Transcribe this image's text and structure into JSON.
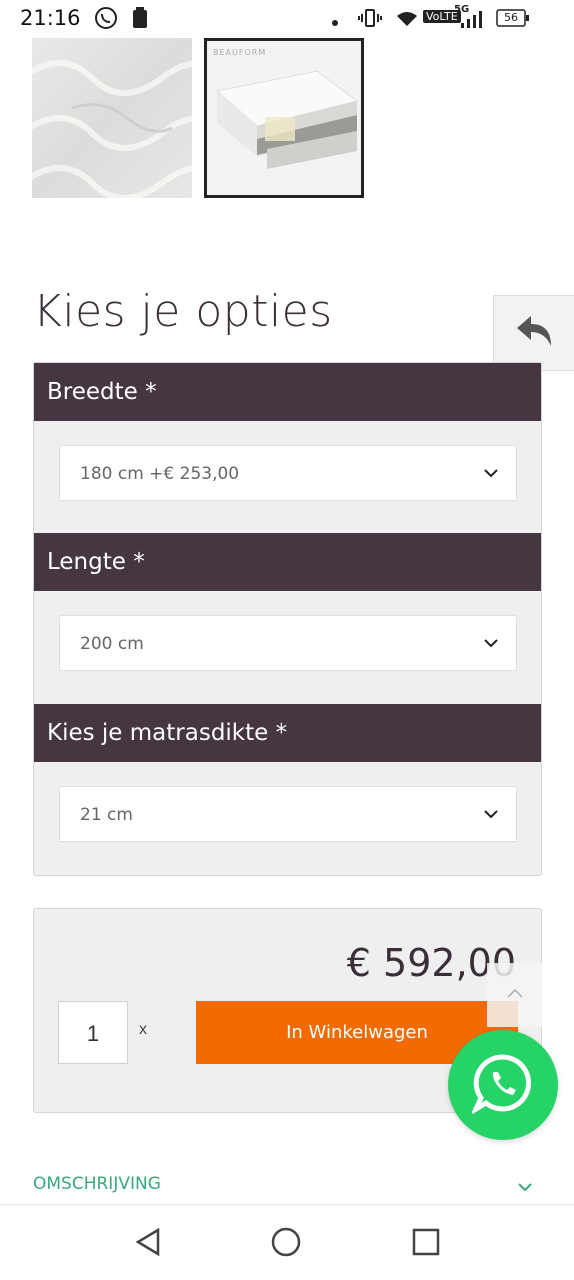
{
  "status_bar": {
    "time": "21:16",
    "network_label": "VoLTE",
    "network_gen": "5G",
    "battery": "56"
  },
  "icons": {
    "whatsapp_status": "whatsapp-icon",
    "notification": "notification-icon",
    "vibrate": "vibrate-icon",
    "wifi": "wifi-icon",
    "signal": "signal-icon",
    "battery": "battery-icon",
    "back": "back-arrow-icon",
    "chevron": "chevron-down-icon",
    "scroll_up": "chevron-up-icon",
    "whatsapp_fab": "whatsapp-icon",
    "nav_back": "nav-back-icon",
    "nav_home": "nav-home-icon",
    "nav_recents": "nav-recents-icon"
  },
  "gallery": {
    "thumb2_logo": "BEAUFORM"
  },
  "options": {
    "title": "Kies je opties",
    "groups": [
      {
        "label": "Breedte *",
        "value": "180 cm +€ 253,00"
      },
      {
        "label": "Lengte *",
        "value": "200 cm"
      },
      {
        "label": "Kies je matrasdikte *",
        "value": "21 cm"
      }
    ]
  },
  "cart": {
    "price": "€ 592,00",
    "quantity": "1",
    "times": "x",
    "add_button": "In Winkelwagen"
  },
  "description": {
    "label": "OMSCHRIJVING"
  },
  "colors": {
    "header_bg": "#453641",
    "accent_orange": "#f26a00",
    "whatsapp_green": "#25d366",
    "link_green": "#3aa87a"
  }
}
